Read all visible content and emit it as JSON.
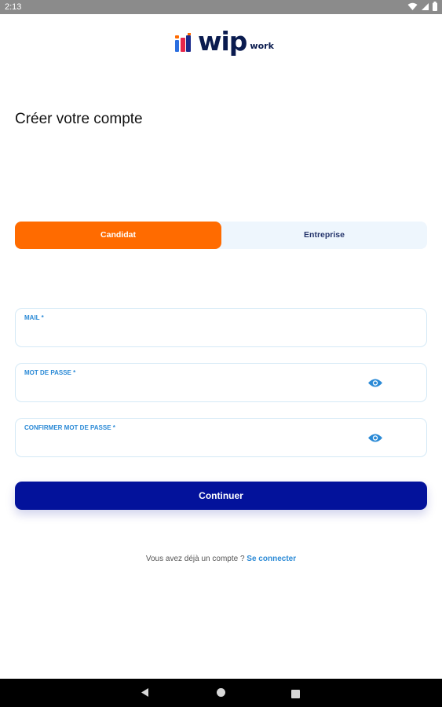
{
  "status_bar": {
    "time": "2:13"
  },
  "logo": {
    "word": "wip",
    "sub": "work"
  },
  "page": {
    "title": "Créer votre compte"
  },
  "account_type": {
    "options": [
      "Candidat",
      "Entreprise"
    ],
    "selected": "Candidat"
  },
  "form": {
    "email": {
      "label": "MAIL *",
      "value": ""
    },
    "password": {
      "label": "MOT DE PASSE *",
      "value": ""
    },
    "confirm_password": {
      "label": "CONFIRMER MOT DE PASSE *",
      "value": ""
    }
  },
  "continue_label": "Continuer",
  "login_prompt": {
    "text": "Vous avez déjà un compte ?",
    "link": "Se connecter"
  },
  "colors": {
    "primary": "#03129b",
    "accent": "#ff6b00",
    "link": "#2b8ad6",
    "navy": "#0a1b4f"
  },
  "icons": [
    "wifi-icon",
    "signal-icon",
    "battery-icon",
    "eye-icon",
    "back-icon",
    "home-icon",
    "recent-apps-icon"
  ]
}
